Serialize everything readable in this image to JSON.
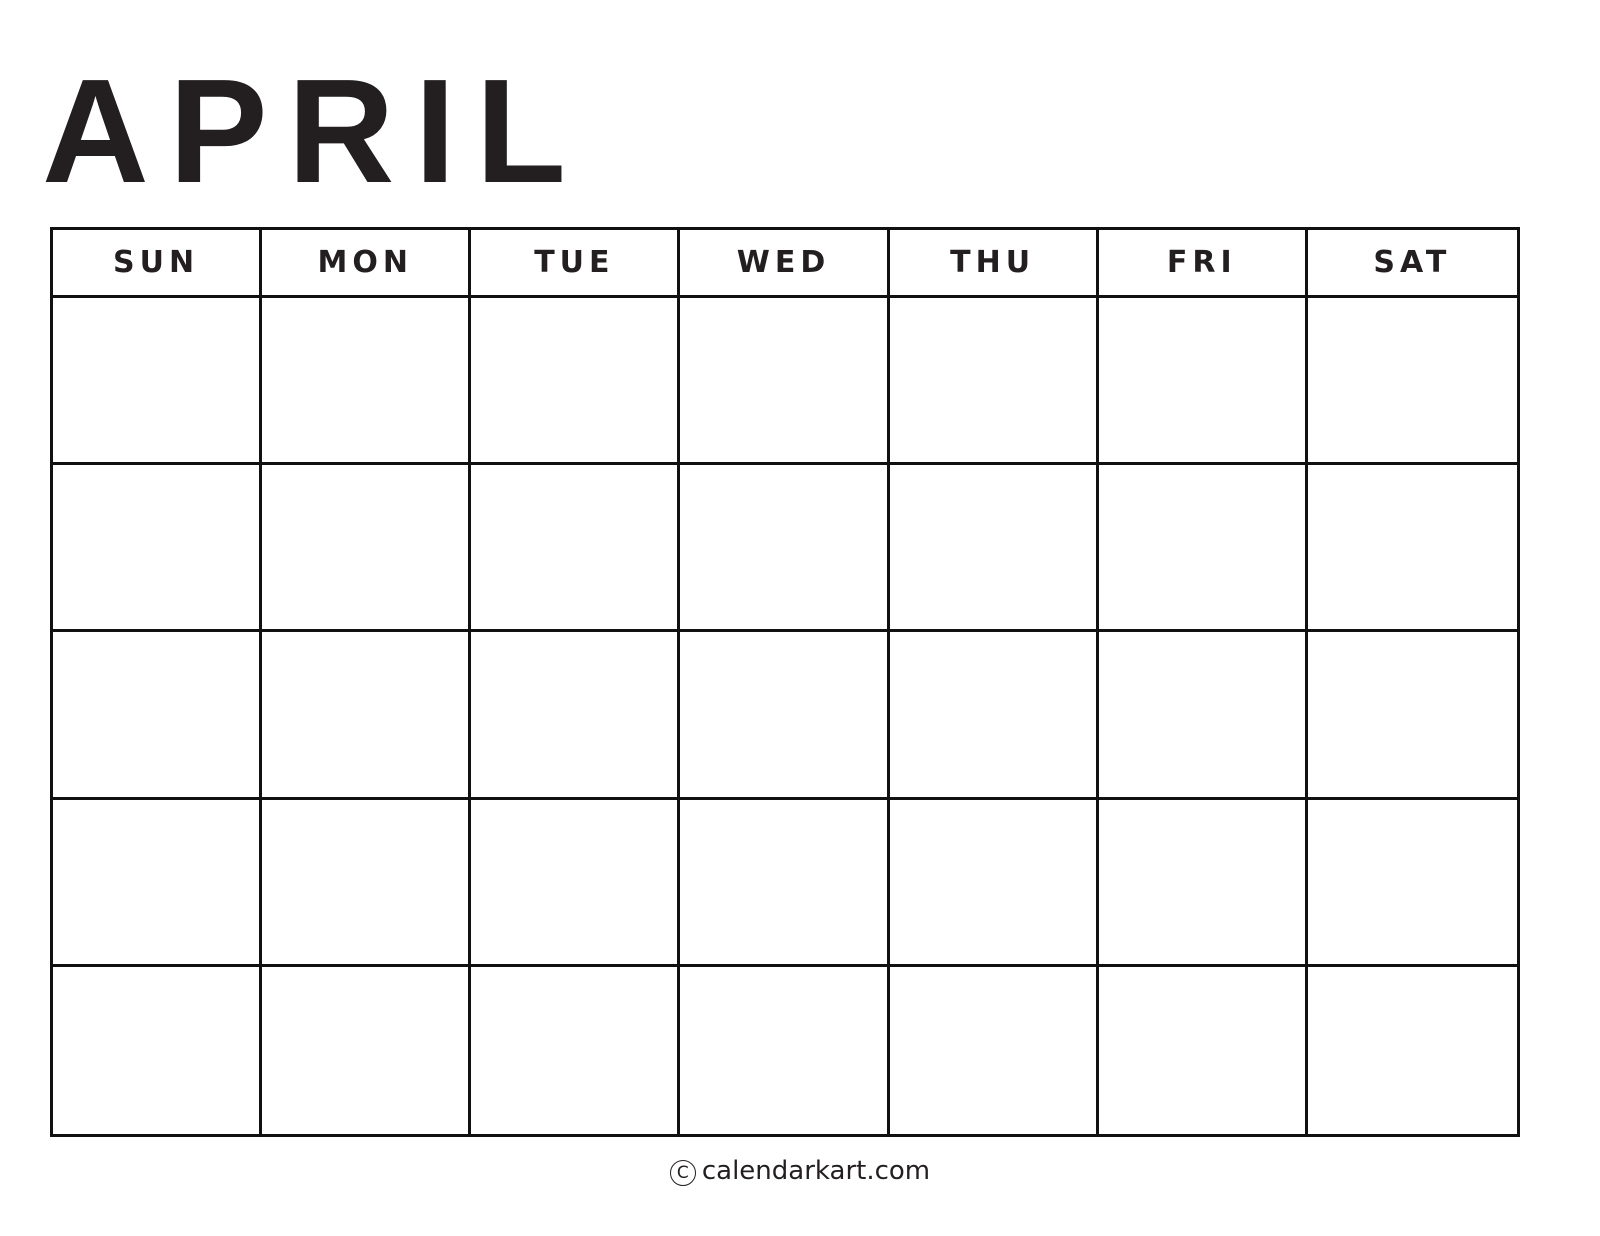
{
  "title": "APRIL",
  "weekdays": [
    "SUN",
    "MON",
    "TUE",
    "WED",
    "THU",
    "FRI",
    "SAT"
  ],
  "weeks": 5,
  "days": [
    [
      "",
      "",
      "",
      "",
      "",
      "",
      ""
    ],
    [
      "",
      "",
      "",
      "",
      "",
      "",
      ""
    ],
    [
      "",
      "",
      "",
      "",
      "",
      "",
      ""
    ],
    [
      "",
      "",
      "",
      "",
      "",
      "",
      ""
    ],
    [
      "",
      "",
      "",
      "",
      "",
      "",
      ""
    ]
  ],
  "footer": {
    "icon": "copyright-icon",
    "icon_glyph": "C",
    "text": "calendarkart.com"
  }
}
